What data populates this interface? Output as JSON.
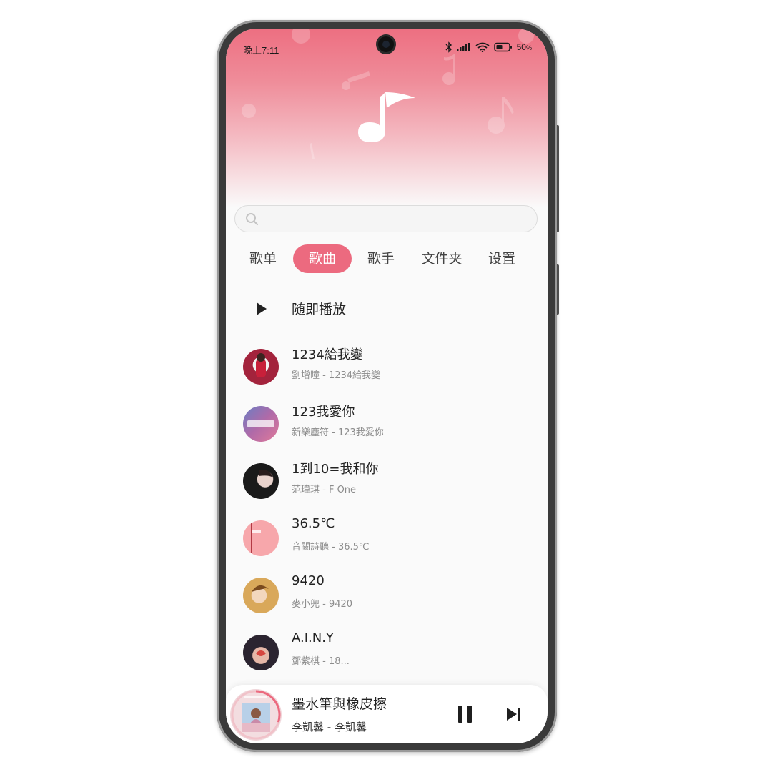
{
  "statusbar": {
    "time": "晚上7:11",
    "battery": "50",
    "battery_unit": "%"
  },
  "search": {
    "placeholder": "",
    "value": ""
  },
  "tabs": [
    {
      "label": "歌单",
      "active": false
    },
    {
      "label": "歌曲",
      "active": true
    },
    {
      "label": "歌手",
      "active": false
    },
    {
      "label": "文件夹",
      "active": false
    },
    {
      "label": "设置",
      "active": false
    }
  ],
  "shuffle": {
    "label": "随即播放",
    "icon": "play-icon"
  },
  "songs": [
    {
      "title": "1234給我變",
      "subtitle": "劉增瞳 - 1234給我變"
    },
    {
      "title": "123我愛你",
      "subtitle": "新樂塵符 - 123我愛你"
    },
    {
      "title": "1到10=我和你",
      "subtitle": "范瑋琪 - F One"
    },
    {
      "title": "36.5℃",
      "subtitle": "音闕詩聽 - 36.5℃"
    },
    {
      "title": "9420",
      "subtitle": "麥小兜 - 9420"
    },
    {
      "title": "A.I.N.Y",
      "subtitle": "鄧紫棋 - 18..."
    }
  ],
  "now_playing": {
    "title": "墨水筆與橡皮擦",
    "subtitle": "李凱馨 - 李凱馨",
    "progress": 0.3
  },
  "colors": {
    "accent": "#ec6a7f",
    "header_top": "#ed6f81"
  }
}
